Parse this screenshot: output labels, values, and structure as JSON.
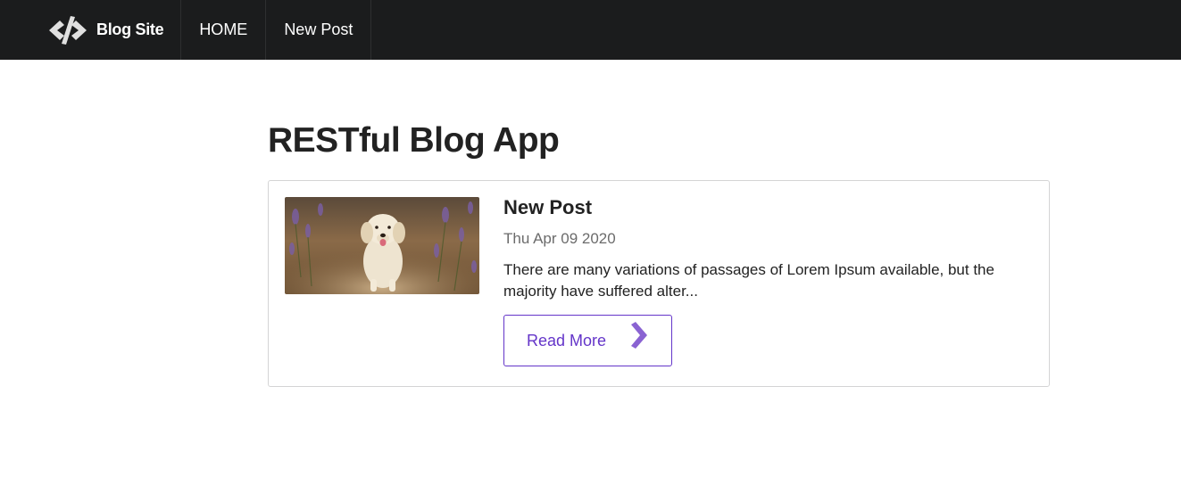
{
  "nav": {
    "brand": "Blog Site",
    "items": [
      {
        "label": "HOME"
      },
      {
        "label": "New Post"
      }
    ]
  },
  "page": {
    "title": "RESTful Blog App"
  },
  "posts": [
    {
      "image_alt": "golden retriever puppy walking on a path",
      "title": "New Post",
      "date": "Thu Apr 09 2020",
      "excerpt": "There are many variations of passages of Lorem Ipsum available, but the majority have suffered alter...",
      "button_label": "Read More"
    }
  ],
  "colors": {
    "navbar_bg": "#1b1c1d",
    "accent": "#6435c9",
    "chevron": "#8a63d2"
  },
  "icons": {
    "brand": "code-icon",
    "read_more": "chevron-right-icon"
  }
}
